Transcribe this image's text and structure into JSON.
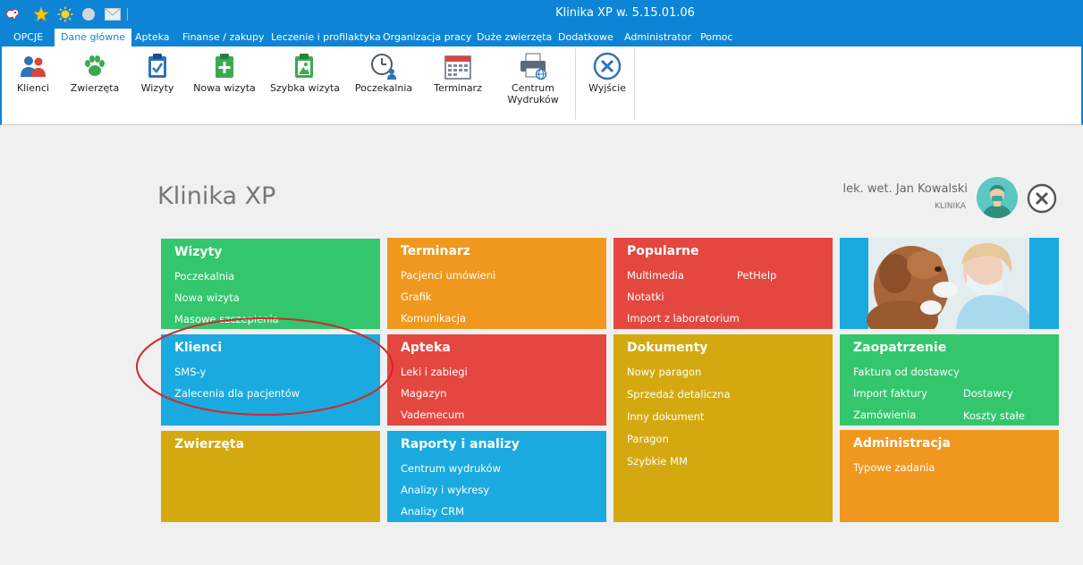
{
  "window": {
    "title": "Klinika XP w. 5.15.01.06"
  },
  "menu": {
    "items": [
      {
        "label": "OPCJE"
      },
      {
        "label": "Dane główne"
      },
      {
        "label": "Apteka"
      },
      {
        "label": "Finanse / zakupy"
      },
      {
        "label": "Leczenie i profilaktyka"
      },
      {
        "label": "Organizacja pracy"
      },
      {
        "label": "Duże zwierzęta"
      },
      {
        "label": "Dodatkowe"
      },
      {
        "label": "Administrator"
      },
      {
        "label": "Pomoc"
      }
    ]
  },
  "ribbon": {
    "buttons": [
      {
        "label": "Klienci",
        "icon": "clients-icon"
      },
      {
        "label": "Zwierzęta",
        "icon": "paw-icon"
      },
      {
        "label": "Wizyty",
        "icon": "clipboard-check-icon"
      },
      {
        "label": "Nowa wizyta",
        "icon": "add-visit-icon"
      },
      {
        "label": "Szybka wizyta",
        "icon": "quick-visit-icon"
      },
      {
        "label": "Poczekalnia",
        "icon": "clock-user-icon"
      },
      {
        "label": "Terminarz",
        "icon": "calendar-icon"
      },
      {
        "label": "Centrum\nWydruków",
        "icon": "printer-icon"
      },
      {
        "label": "Wyjście",
        "icon": "exit-icon"
      }
    ]
  },
  "header": {
    "title": "Klinika XP",
    "user_name": "lek. wet. Jan Kowalski",
    "user_role": "KLINIKA"
  },
  "tiles": {
    "wizyty": {
      "title": "Wizyty",
      "links": [
        "Poczekalnia",
        "Nowa wizyta",
        "Masowe szczepienia"
      ]
    },
    "terminarz": {
      "title": "Terminarz",
      "links": [
        "Pacjenci umówieni",
        "Grafik",
        "Komunikacja"
      ]
    },
    "popularne": {
      "title": "Popularne",
      "links": [
        "Multimedia",
        "PetHelp",
        "Notatki",
        "Import z laboratorium"
      ]
    },
    "klienci": {
      "title": "Klienci",
      "links": [
        "SMS-y",
        "Zalecenia dla pacjentów"
      ]
    },
    "apteka": {
      "title": "Apteka",
      "links": [
        "Leki i zabiegi",
        "Magazyn",
        "Vademecum"
      ]
    },
    "dokumenty": {
      "title": "Dokumenty",
      "links": [
        "Nowy paragon",
        "Sprzedaż detaliczna",
        "Inny dokument",
        "Paragon",
        "Szybkie MM"
      ]
    },
    "zaopatrzenie": {
      "title": "Zaopatrzenie",
      "links": [
        "Faktura od dostawcy",
        "Import faktury",
        "Dostawcy",
        "Zamówienia",
        "Koszty stałe"
      ]
    },
    "zwierzeta": {
      "title": "Zwierzęta",
      "links": []
    },
    "raporty": {
      "title": "Raporty i analizy",
      "links": [
        "Centrum wydruków",
        "Analizy i wykresy",
        "Analizy CRM"
      ]
    },
    "administracja": {
      "title": "Administracja",
      "links": [
        "Typowe zadania"
      ]
    }
  },
  "colors": {
    "titlebar": "#0e84d6",
    "green": "#33c66d",
    "orange": "#f0981e",
    "red": "#e4473f",
    "blue": "#1aaadf",
    "gold": "#d4a80f",
    "annotation": "#d4262b"
  }
}
